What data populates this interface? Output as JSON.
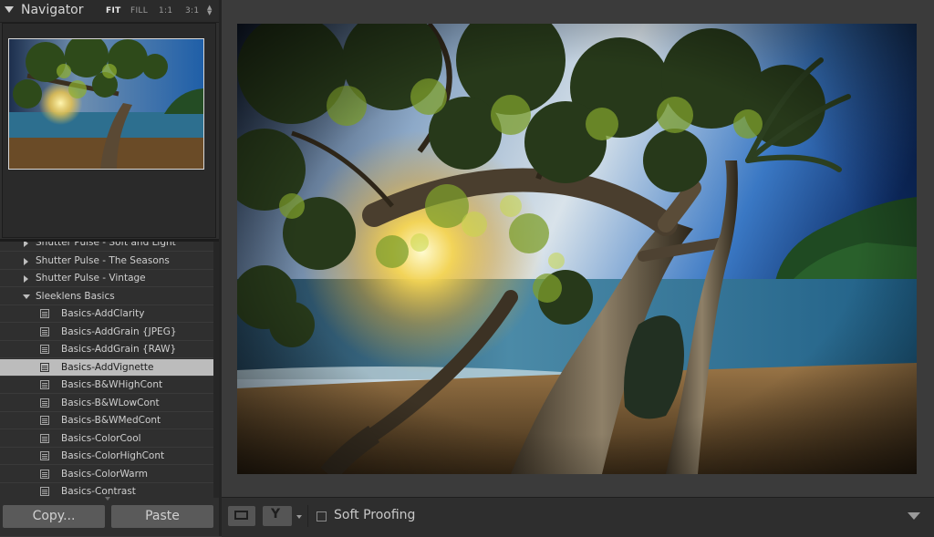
{
  "navigator": {
    "title": "Navigator",
    "zoom": {
      "fit": "FIT",
      "fill": "FILL",
      "one": "1:1",
      "three": "3:1"
    }
  },
  "presets": {
    "rows": [
      {
        "type": "folder",
        "label": "Shutter Pulse - Soft and Light",
        "expanded": false
      },
      {
        "type": "folder",
        "label": "Shutter Pulse - The Seasons",
        "expanded": false
      },
      {
        "type": "folder",
        "label": "Shutter Pulse - Vintage",
        "expanded": false
      },
      {
        "type": "folder",
        "label": "Sleeklens Basics",
        "expanded": true
      },
      {
        "type": "item",
        "label": "Basics-AddClarity"
      },
      {
        "type": "item",
        "label": "Basics-AddGrain {JPEG}"
      },
      {
        "type": "item",
        "label": "Basics-AddGrain {RAW}"
      },
      {
        "type": "item",
        "label": "Basics-AddVignette",
        "selected": true
      },
      {
        "type": "item",
        "label": "Basics-B&WHighCont"
      },
      {
        "type": "item",
        "label": "Basics-B&WLowCont"
      },
      {
        "type": "item",
        "label": "Basics-B&WMedCont"
      },
      {
        "type": "item",
        "label": "Basics-ColorCool"
      },
      {
        "type": "item",
        "label": "Basics-ColorHighCont"
      },
      {
        "type": "item",
        "label": "Basics-ColorWarm"
      },
      {
        "type": "item",
        "label": "Basics-Contrast"
      }
    ]
  },
  "actions": {
    "copy": "Copy...",
    "paste": "Paste"
  },
  "toolbar": {
    "soft_proofing": "Soft Proofing",
    "soft_proofing_checked": false
  },
  "colors": {
    "selected_row": "#bcbcbc",
    "panel": "#2f2f2f",
    "background": "#3b3b3b"
  }
}
